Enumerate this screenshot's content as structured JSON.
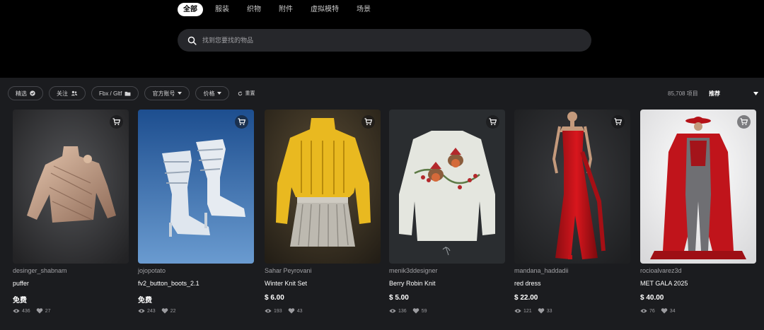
{
  "header": {
    "tabs": [
      {
        "label": "全部",
        "active": true
      },
      {
        "label": "服装",
        "active": false
      },
      {
        "label": "织物",
        "active": false
      },
      {
        "label": "附件",
        "active": false
      },
      {
        "label": "虚拟模特",
        "active": false
      },
      {
        "label": "场景",
        "active": false
      }
    ],
    "search_placeholder": "找到您要找的物品"
  },
  "filters": {
    "featured": "精选",
    "following": "关注",
    "format": "Fbx / Gltf",
    "official": "官方账号",
    "price": "价格",
    "reset": "重置"
  },
  "results": {
    "count": "85,708 项目",
    "sort": "推荐"
  },
  "colors": {
    "page_bg": "#000000",
    "content_bg": "#1b1c1f",
    "search_bg": "#26272b"
  },
  "cards": [
    {
      "author": "desinger_shabnam",
      "name": "puffer",
      "price": "免费",
      "views": "436",
      "likes": "27"
    },
    {
      "author": "jojopotato",
      "name": "fv2_button_boots_2.1",
      "price": "免费",
      "views": "243",
      "likes": "22"
    },
    {
      "author": "Sahar Peyrovani",
      "name": "Winter Knit Set",
      "price": "$ 6.00",
      "views": "193",
      "likes": "43"
    },
    {
      "author": "menik3ddesigner",
      "name": "Berry Robin Knit",
      "price": "$ 5.00",
      "views": "136",
      "likes": "59"
    },
    {
      "author": "mandana_haddadii",
      "name": "red dress",
      "price": "$ 22.00",
      "views": "121",
      "likes": "33"
    },
    {
      "author": "rocioalvarez3d",
      "name": "MET GALA 2025",
      "price": "$ 40.00",
      "views": "76",
      "likes": "34"
    }
  ]
}
